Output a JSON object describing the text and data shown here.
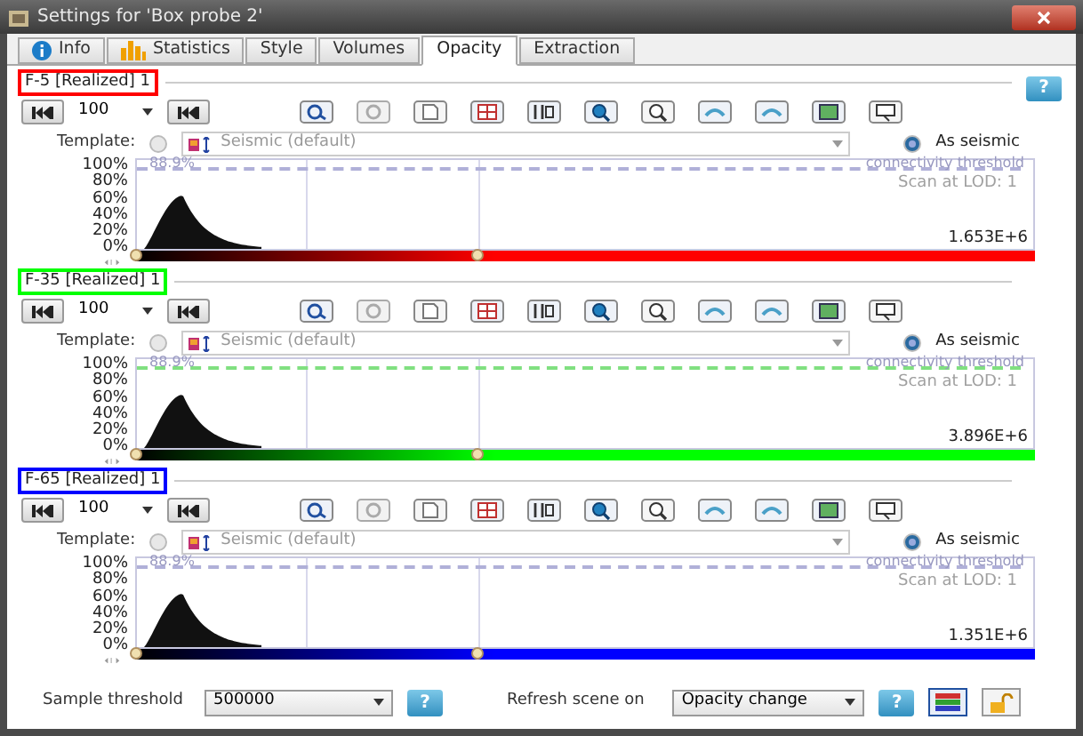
{
  "window": {
    "title": "Settings for 'Box probe 2'"
  },
  "tabs": [
    {
      "label": "Info",
      "selected": false,
      "kind": "info"
    },
    {
      "label": "Statistics",
      "selected": false,
      "kind": "stats"
    },
    {
      "label": "Style",
      "selected": false,
      "kind": "plain"
    },
    {
      "label": "Volumes",
      "selected": false,
      "kind": "plain"
    },
    {
      "label": "Opacity",
      "selected": true,
      "kind": "plain"
    },
    {
      "label": "Extraction",
      "selected": false,
      "kind": "plain"
    }
  ],
  "help_button": "?",
  "panels": [
    {
      "title": "F-5 [Realized]  1",
      "color": "#ff0000",
      "step": "100",
      "template_label": "Template:",
      "template_selected": false,
      "template_value": "Seismic (default)",
      "template_disabled": true,
      "as_seismic_label": "As seismic",
      "as_seismic_selected": true,
      "axis_labels": [
        "100%",
        "80%",
        "60%",
        "40%",
        "20%",
        "0%"
      ],
      "threshold_label": "88.9%",
      "threshold_text": "connectivity threshold",
      "scan_text": "Scan at LOD: 1",
      "max_value": "1.653E+6"
    },
    {
      "title": "F-35 [Realized]  1",
      "color": "#00ff00",
      "step": "100",
      "template_label": "Template:",
      "template_selected": false,
      "template_value": "Seismic (default)",
      "template_disabled": true,
      "as_seismic_label": "As seismic",
      "as_seismic_selected": true,
      "axis_labels": [
        "100%",
        "80%",
        "60%",
        "40%",
        "20%",
        "0%"
      ],
      "threshold_label": "88.9%",
      "threshold_text": "connectivity threshold",
      "scan_text": "Scan at LOD: 1",
      "max_value": "3.896E+6"
    },
    {
      "title": "F-65 [Realized]  1",
      "color": "#0000ff",
      "step": "100",
      "template_label": "Template:",
      "template_selected": false,
      "template_value": "Seismic (default)",
      "template_disabled": true,
      "as_seismic_label": "As seismic",
      "as_seismic_selected": true,
      "axis_labels": [
        "100%",
        "80%",
        "60%",
        "40%",
        "20%",
        "0%"
      ],
      "threshold_label": "88.9%",
      "threshold_text": "connectivity threshold",
      "scan_text": "Scan at LOD: 1",
      "max_value": "1.351E+6"
    }
  ],
  "footer": {
    "sample_label": "Sample threshold",
    "sample_value": "500000",
    "sample_help": "?",
    "refresh_label": "Refresh scene on",
    "refresh_value": "Opacity change",
    "refresh_help": "?"
  }
}
